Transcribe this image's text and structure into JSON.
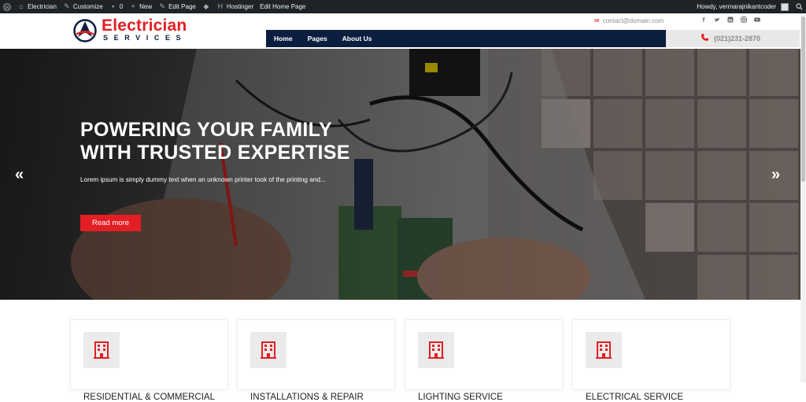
{
  "adminbar": {
    "site_name": "Electrician",
    "customize": "Customize",
    "comments_count": "0",
    "new": "New",
    "edit_page": "Edit Page",
    "hostinger": "Hostinger",
    "edit_home_page": "Edit Home Page",
    "howdy": "Howdy, vermarajnikantcoder"
  },
  "header": {
    "logo_title": "Electrician",
    "logo_subtitle": "SERVICES",
    "email": "contact@domain.com",
    "phone": "(021)231-2870",
    "social_icons": [
      "facebook-icon",
      "twitter-icon",
      "linkedin-icon",
      "instagram-icon",
      "youtube-icon"
    ],
    "nav": [
      "Home",
      "Pages",
      "About Us"
    ]
  },
  "hero": {
    "title_line1": "POWERING YOUR FAMILY",
    "title_line2": "WITH TRUSTED EXPERTISE",
    "text": "Lorem ipsum is simply dummy text when an unknown printer took of the printing and...",
    "button": "Read more",
    "prev_arrow": "«",
    "next_arrow": "»"
  },
  "services": [
    {
      "title": "RESIDENTIAL & COMMERCIAL",
      "icon": "building-icon"
    },
    {
      "title": "INSTALLATIONS & REPAIR",
      "icon": "building-icon"
    },
    {
      "title": "LIGHTING SERVICE",
      "icon": "building-icon"
    },
    {
      "title": "ELECTRICAL SERVICE",
      "icon": "building-icon"
    }
  ],
  "colors": {
    "brand_red": "#e31e24",
    "navy": "#0b1e3f",
    "adminbar": "#1d2327"
  }
}
